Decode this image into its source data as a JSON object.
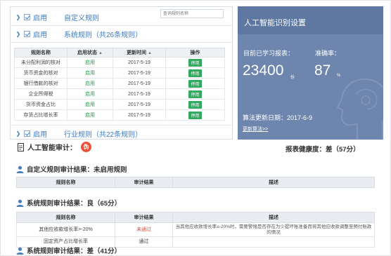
{
  "rules": {
    "custom": {
      "enable_label": "启用",
      "title": "自定义规则",
      "search_placeholder": "查询规则名称"
    },
    "system": {
      "enable_label": "启用",
      "title": "系统规则（共26条规则）"
    },
    "industry": {
      "enable_label": "启用",
      "title": "行业规则（共22条规则）"
    },
    "table": {
      "headers": [
        "规则名称",
        "启用状态",
        "更新时间",
        "操作"
      ],
      "rows": [
        {
          "name": "未分配利润的核对",
          "status": "启用",
          "date": "2017-5-19",
          "op": "停用"
        },
        {
          "name": "货币资金的核对",
          "status": "启用",
          "date": "2017-5-19",
          "op": "停用"
        },
        {
          "name": "银行借款的核对",
          "status": "启用",
          "date": "2017-5-19",
          "op": "停用"
        },
        {
          "name": "企业所得税",
          "status": "启用",
          "date": "2017-5-19",
          "op": "停用"
        },
        {
          "name": "货币资金占比",
          "status": "启用",
          "date": "2017-5-19",
          "op": "停用"
        },
        {
          "name": "存货占比增长率",
          "status": "启用",
          "date": "2017-5-19",
          "op": "停用"
        }
      ]
    }
  },
  "ai": {
    "title": "人工智能识别设置",
    "learned_label": "目前已学习报表：",
    "learned_value": "23400",
    "learned_unit": "份",
    "accuracy_label": "准确率：",
    "accuracy_value": "87",
    "accuracy_unit": "%",
    "update_date": "算法更新日期：2017-6-9",
    "update_link": "更新算法>>",
    "colors": {
      "panel": "#6e86ad",
      "title_bar": "#5f78a1"
    }
  },
  "report": {
    "ai_audit_label": "人工智能审计：",
    "ai_audit_badge": "伪",
    "health": "报表健康度：差（57分）",
    "custom_result": "自定义规则审计结果：未启用规则",
    "custom_table_headers": [
      "规则名称",
      "审计结果",
      "描述"
    ],
    "system_result": "系统规则审计结果：良（65分）",
    "system_table_headers": [
      "规则名称",
      "审计结果",
      "描述"
    ],
    "system_rows": [
      {
        "name": "其他应收款增长率>-20%",
        "result": "未通过",
        "desc": "当其他应收款增长率≤-20%时，需要警惕是否存在为少提坏账准备而将其他应收款调整至预付账款的情况"
      },
      {
        "name": "固定资产占比增长率",
        "result": "通过",
        "desc": ""
      }
    ],
    "industry_result": "系统规则审计结果：差（41分）"
  }
}
